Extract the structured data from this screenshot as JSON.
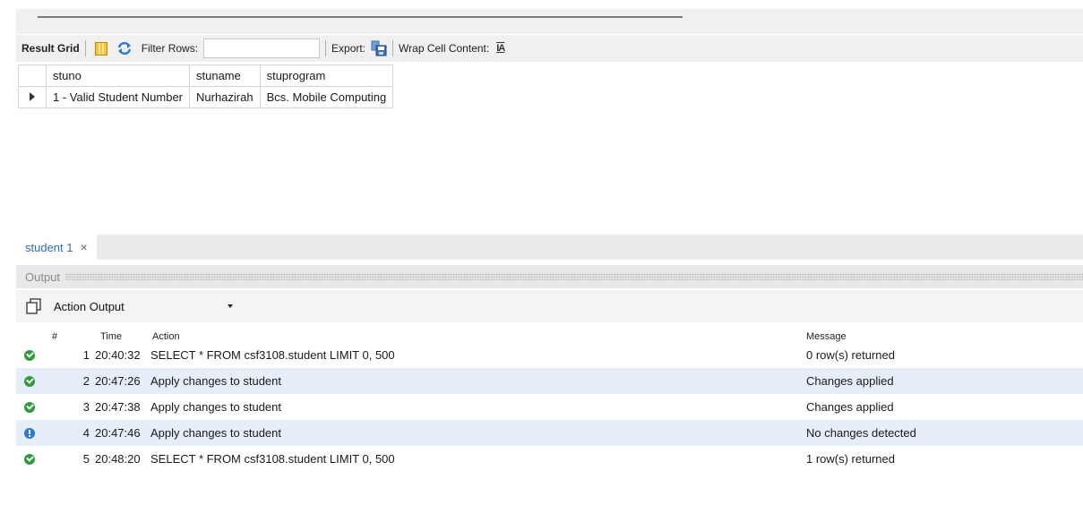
{
  "toolbar": {
    "result_grid_label": "Result Grid",
    "filter_rows_label": "Filter Rows:",
    "filter_rows_value": "",
    "export_label": "Export:",
    "wrap_cell_label": "Wrap Cell Content:",
    "wrap_icon_glyph": "IA"
  },
  "result_grid": {
    "columns": [
      "stuno",
      "stuname",
      "stuprogram"
    ],
    "rows": [
      {
        "stuno": "1 - Valid Student Number",
        "stuname": "Nurhazirah",
        "stuprogram": "Bcs. Mobile Computing"
      }
    ]
  },
  "tabs": [
    {
      "label": "student 1",
      "close_glyph": "×"
    }
  ],
  "output": {
    "title": "Output",
    "selector_label": "Action Output",
    "columns": {
      "num": "#",
      "time": "Time",
      "action": "Action",
      "message": "Message"
    },
    "entries": [
      {
        "status": "ok",
        "num": "1",
        "time": "20:40:32",
        "action": "SELECT * FROM csf3108.student LIMIT 0, 500",
        "message": "0 row(s) returned"
      },
      {
        "status": "ok",
        "num": "2",
        "time": "20:47:26",
        "action": "Apply changes to student",
        "message": "Changes applied"
      },
      {
        "status": "ok",
        "num": "3",
        "time": "20:47:38",
        "action": "Apply changes to student",
        "message": "Changes applied"
      },
      {
        "status": "info",
        "num": "4",
        "time": "20:47:46",
        "action": "Apply changes to student",
        "message": "No changes detected"
      },
      {
        "status": "ok",
        "num": "5",
        "time": "20:48:20",
        "action": "SELECT * FROM csf3108.student LIMIT 0, 500",
        "message": "1 row(s) returned"
      }
    ]
  },
  "icons": {
    "grid_view": "grid-view-icon",
    "refresh": "refresh-icon",
    "export": "export-save-icon",
    "wrap": "wrap-cell-icon",
    "copy": "copy-icon",
    "status_ok": "check-circle-icon",
    "status_info": "info-circle-icon",
    "row_pointer": "row-pointer-icon"
  },
  "colors": {
    "status_ok": "#2e9a3c",
    "status_info": "#2a7bd0",
    "tab_title": "#2a6eb5",
    "alt_row": "#e6eef9"
  }
}
